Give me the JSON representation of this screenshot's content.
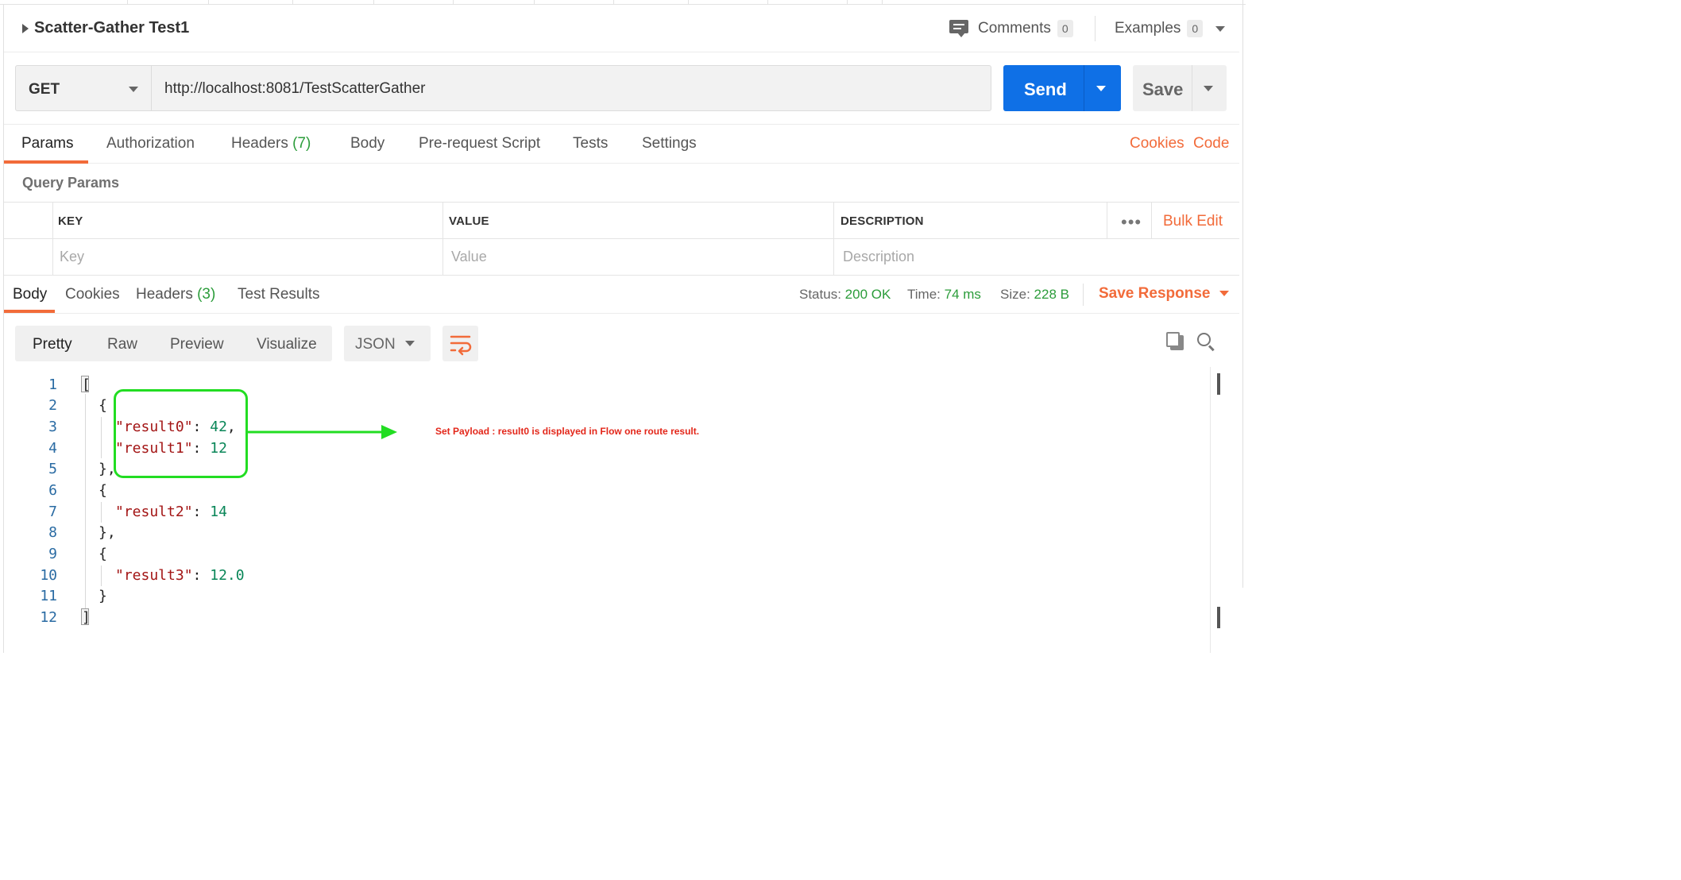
{
  "request": {
    "title": "Scatter-Gather Test1",
    "comments_label": "Comments",
    "comments_count": "0",
    "examples_label": "Examples",
    "examples_count": "0",
    "method": "GET",
    "url": "http://localhost:8081/TestScatterGather",
    "send_label": "Send",
    "save_label": "Save"
  },
  "request_tabs": {
    "params": "Params",
    "authorization": "Authorization",
    "headers": "Headers",
    "headers_count": "(7)",
    "body": "Body",
    "prerequest": "Pre-request Script",
    "tests": "Tests",
    "settings": "Settings",
    "cookies": "Cookies",
    "code": "Code"
  },
  "query_params": {
    "title": "Query Params",
    "headers": {
      "key": "KEY",
      "value": "VALUE",
      "description": "DESCRIPTION"
    },
    "bulk_edit": "Bulk Edit",
    "placeholders": {
      "key": "Key",
      "value": "Value",
      "description": "Description"
    }
  },
  "response": {
    "tabs": {
      "body": "Body",
      "cookies": "Cookies",
      "headers": "Headers",
      "headers_count": "(3)",
      "test_results": "Test Results"
    },
    "status_label": "Status:",
    "status_value": "200 OK",
    "time_label": "Time:",
    "time_value": "74 ms",
    "size_label": "Size:",
    "size_value": "228 B",
    "save_response": "Save Response",
    "views": {
      "pretty": "Pretty",
      "raw": "Raw",
      "preview": "Preview",
      "visualize": "Visualize"
    },
    "format": "JSON"
  },
  "code": {
    "line_numbers": [
      "1",
      "2",
      "3",
      "4",
      "5",
      "6",
      "7",
      "8",
      "9",
      "10",
      "11",
      "12"
    ],
    "open_array": "[",
    "close_array": "]",
    "open_obj": "{",
    "close_obj_comma": "},",
    "close_obj": "}",
    "result0_key": "\"result0\"",
    "result0_value": "42",
    "result1_key": "\"result1\"",
    "result1_value": "12",
    "result2_key": "\"result2\"",
    "result2_value": "14",
    "result3_key": "\"result3\"",
    "result3_value": "12.0",
    "colon": ": ",
    "comma": ","
  },
  "annotation": {
    "text": "Set Payload : result0 is displayed in Flow one route result.",
    "box_color": "#22dd22",
    "text_color": "#e3271a"
  },
  "colors": {
    "accent_orange": "#f26b3a",
    "send_blue": "#0f70e6",
    "success_green": "#2b9c3a"
  }
}
